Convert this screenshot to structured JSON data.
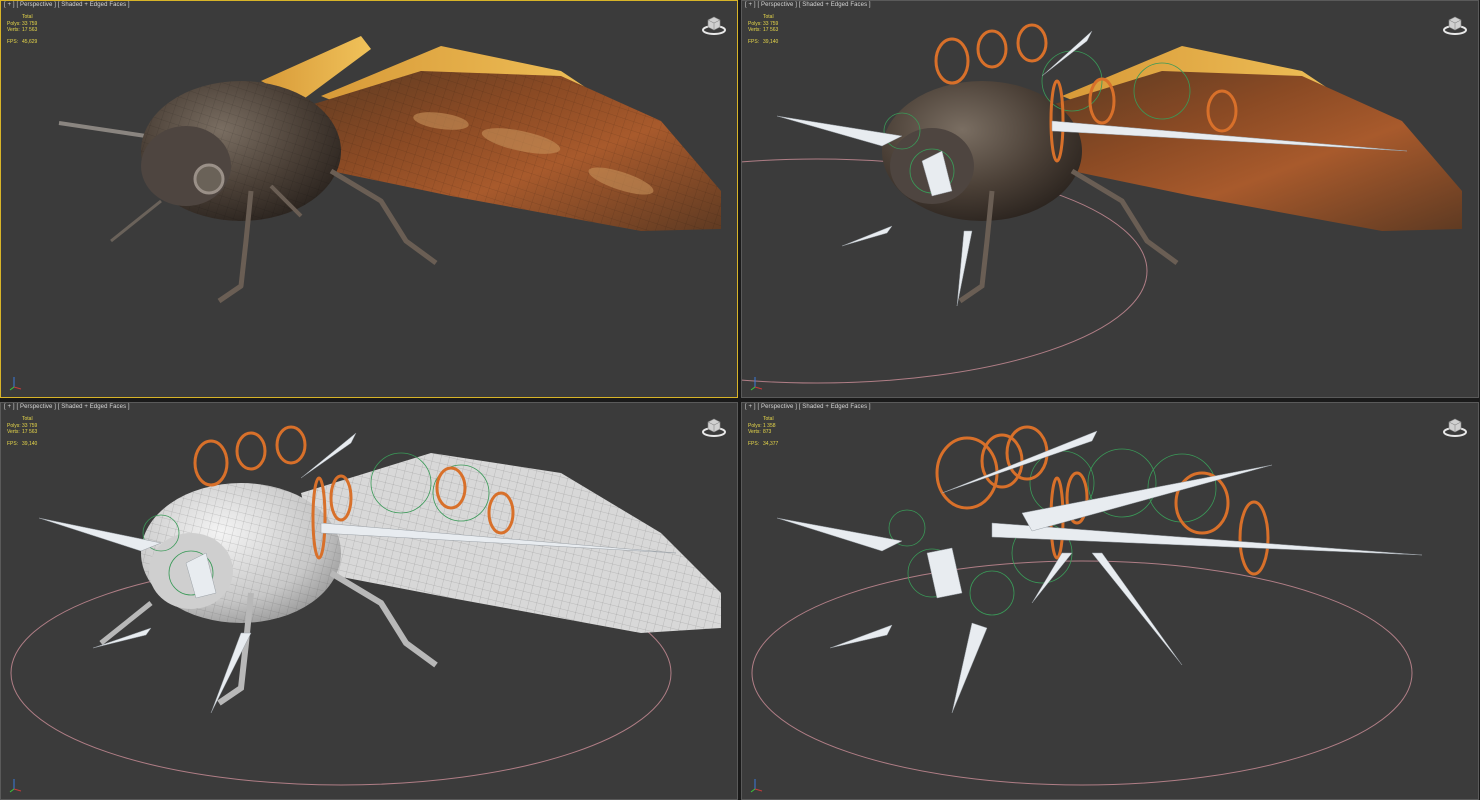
{
  "viewports": [
    {
      "label_plus": "[ + ]",
      "label_view": "[ Perspective ]",
      "label_shade": "[ Shaded + Edged Faces ]",
      "total": "Total",
      "polys_key": "Polys:",
      "polys": "33 759",
      "verts_key": "Verts:",
      "verts": "17 563",
      "fps_key": "FPS:",
      "fps": "45,629",
      "mode": "textured",
      "active": true
    },
    {
      "label_plus": "[ + ]",
      "label_view": "[ Perspective ]",
      "label_shade": "[ Shaded + Edged Faces ]",
      "total": "Total",
      "polys_key": "Polys:",
      "polys": "33 759",
      "verts_key": "Verts:",
      "verts": "17 563",
      "fps_key": "FPS:",
      "fps": "39,140",
      "mode": "textured-rig",
      "active": false
    },
    {
      "label_plus": "[ + ]",
      "label_view": "[ Perspective ]",
      "label_shade": "[ Shaded + Edged Faces ]",
      "total": "Total",
      "polys_key": "Polys:",
      "polys": "33 759",
      "verts_key": "Verts:",
      "verts": "17 563",
      "fps_key": "FPS:",
      "fps": "39,140",
      "mode": "clay-rig",
      "active": false
    },
    {
      "label_plus": "[ + ]",
      "label_view": "[ Perspective ]",
      "label_shade": "[ Shaded + Edged Faces ]",
      "total": "Total",
      "polys_key": "Polys:",
      "polys": "1 358",
      "verts_key": "Verts:",
      "verts": "873",
      "fps_key": "FPS:",
      "fps": "34,377",
      "mode": "bones-only",
      "active": false
    }
  ],
  "colors": {
    "viewport_bg": "#3b3b3b",
    "active_border": "#d8b428",
    "stats": "#e8d84a",
    "rig_orange": "#d8702a",
    "rig_green": "#3a9a58",
    "bone": "#e8ecf0",
    "ground": "#b07e86"
  }
}
